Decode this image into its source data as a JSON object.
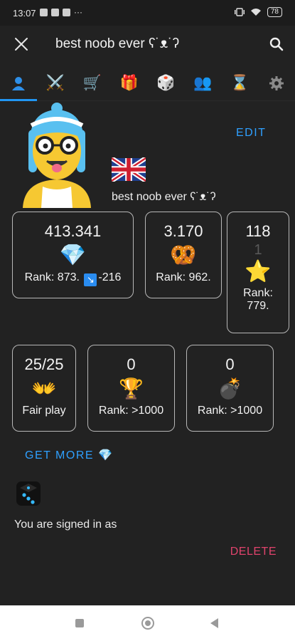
{
  "status_bar": {
    "time": "13:07",
    "dots": "···",
    "battery": "78"
  },
  "header": {
    "title": "best noob ever ʕ˙ᴥ˙ʔ"
  },
  "tabs": [
    {
      "name": "profile",
      "icon": "👤",
      "active": true
    },
    {
      "name": "battle",
      "icon": "⚔️"
    },
    {
      "name": "shop",
      "icon": "🛒"
    },
    {
      "name": "gifts",
      "icon": "🎁"
    },
    {
      "name": "dice",
      "icon": "🎲"
    },
    {
      "name": "friends",
      "icon": "👥"
    },
    {
      "name": "history",
      "icon": "⌛"
    },
    {
      "name": "settings",
      "icon": "⚙️"
    }
  ],
  "profile": {
    "edit_label": "EDIT",
    "flag": "united-kingdom-flag",
    "username": "best noob ever ʕ˙ᴥ˙ʔ"
  },
  "stats": {
    "diamonds": {
      "value": "413.341",
      "icon": "💎",
      "rank_label": "Rank: 873.",
      "change_icon": "↘",
      "change": "-216"
    },
    "pretzels": {
      "value": "3.170",
      "icon": "🥨",
      "rank_label": "Rank: 962."
    },
    "stars": {
      "value": "118",
      "secondary": "1",
      "icon": "⭐",
      "rank_label": "Rank:",
      "rank_value": "779."
    },
    "fair_play": {
      "value": "25/25",
      "icon": "👐",
      "label": "Fair play"
    },
    "trophies": {
      "value": "0",
      "icon": "🏆",
      "rank_label": "Rank: >1000"
    },
    "bombs": {
      "value": "0",
      "icon": "💣",
      "rank_label": "Rank: >1000"
    }
  },
  "get_more_label": "GET MORE 💎",
  "account": {
    "signed_in_text": "You are signed in as",
    "delete_label": "DELETE"
  },
  "colors": {
    "background": "#222222",
    "accent": "#2fa0ff",
    "delete": "#e0436c",
    "tab_indicator": "#2196f3"
  }
}
